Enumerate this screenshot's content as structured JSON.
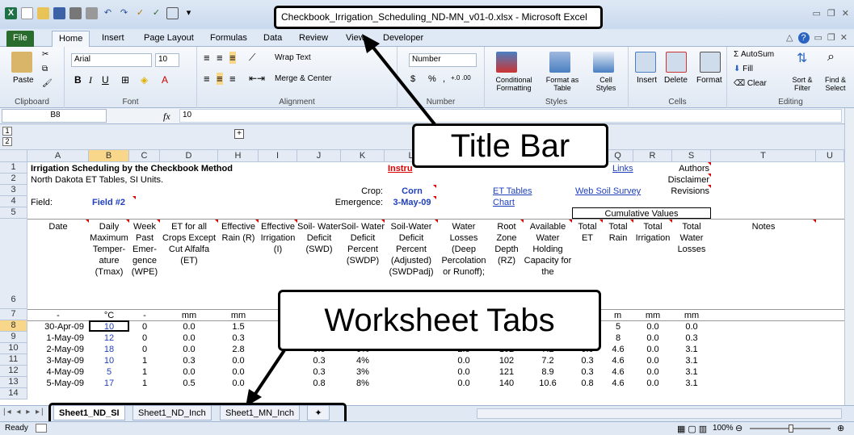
{
  "window": {
    "title": "Checkbook_Irrigation_Scheduling_ND-MN_v01-0.xlsx - Microsoft Excel"
  },
  "ribbon_tabs": [
    "File",
    "Home",
    "Insert",
    "Page Layout",
    "Formulas",
    "Data",
    "Review",
    "View",
    "Developer"
  ],
  "ribbon": {
    "clipboard": {
      "label": "Clipboard",
      "paste": "Paste"
    },
    "font": {
      "label": "Font",
      "name": "Arial",
      "size": "10",
      "bold": "B",
      "italic": "I",
      "underline": "U"
    },
    "alignment": {
      "label": "Alignment",
      "wrap": "Wrap Text",
      "merge": "Merge & Center"
    },
    "number": {
      "label": "Number",
      "format": "Number",
      "currency": "$",
      "percent": "%",
      "comma": ",",
      "inc": "+.0 .00",
      "dec": ".00 +.0"
    },
    "styles": {
      "label": "Styles",
      "cond": "Conditional Formatting",
      "format_table": "Format as Table",
      "cell_styles": "Cell Styles"
    },
    "cells": {
      "label": "Cells",
      "insert": "Insert",
      "delete": "Delete",
      "format": "Format"
    },
    "editing": {
      "label": "Editing",
      "autosum": "AutoSum",
      "fill": "Fill",
      "clear": "Clear",
      "sort": "Sort & Filter",
      "find": "Find & Select"
    }
  },
  "formula_bar": {
    "name_box": "B8",
    "fx": "fx",
    "value": "10"
  },
  "columns": [
    "A",
    "B",
    "C",
    "D",
    "H",
    "I",
    "J",
    "K",
    "L",
    "M",
    "N",
    "O",
    "P",
    "Q",
    "R",
    "S",
    "T",
    "U"
  ],
  "rows": [
    "1",
    "2",
    "3",
    "4",
    "5",
    "6",
    "7",
    "8",
    "9",
    "10",
    "11",
    "12",
    "13",
    "14"
  ],
  "sheet": {
    "r1_title": "Irrigation Scheduling by the Checkbook Method",
    "r1_instr": "Instru",
    "r1_links": "Links",
    "r1_authors": "Authors",
    "r2_subtitle": "North Dakota ET Tables, SI Units.",
    "r2_disclaimer": "Disclaimer",
    "r3_crop_label": "Crop:",
    "r3_crop": "Corn",
    "r3_et_tables": "ET Tables",
    "r3_web_soil": "Web Soil Survey",
    "r3_revisions": "Revisions",
    "r4_field_label": "Field:",
    "r4_field": "Field #2",
    "r4_emergence_label": "Emergence:",
    "r4_emergence": "3-May-09",
    "r4_chart": "Chart",
    "r5_cumulative": "Cumulative Values",
    "h_date": "Date",
    "h_B": "Daily Maximum Temper- ature (Tmax)",
    "h_C": "Week Past Emer- gence (WPE)",
    "h_D": "ET for all Crops Except Cut Alfalfa (ET)",
    "h_H": "Effective Rain (R)",
    "h_I": "Effective Irrigation (I)",
    "h_J": "Soil- Water Deficit (SWD)",
    "h_K": "Soil- Water Deficit Percent (SWDP)",
    "h_L": "Soil-Water Deficit Percent (Adjusted) (SWDPadj)",
    "h_M": "Water Losses (Deep Percolation or Runoff);",
    "h_N": "Root Zone Depth (RZ)",
    "h_O": "Available Water Holding Capacity for the",
    "h_P": "Total ET",
    "h_Q": "Total Rain",
    "h_R": "Total Irrigation",
    "h_S": "Total Water Losses",
    "h_T": "Notes",
    "units": {
      "A": "-",
      "B": "°C",
      "C": "-",
      "D": "mm",
      "H": "mm",
      "Q": "m",
      "R": "mm",
      "S": "mm"
    },
    "data": [
      {
        "date": "30-Apr-09",
        "B": "10",
        "C": "0",
        "D": "0.0",
        "H": "1.5",
        "J": "",
        "K": "",
        "M": "",
        "N": "",
        "O": "",
        "P": "",
        "Q": "5",
        "R": "0.0",
        "S": "0.0"
      },
      {
        "date": "1-May-09",
        "B": "12",
        "C": "0",
        "D": "0.0",
        "H": "0.3",
        "J": "",
        "K": "",
        "M": "",
        "N": "",
        "O": "",
        "P": "",
        "Q": "8",
        "R": "0.0",
        "S": "0.3"
      },
      {
        "date": "2-May-09",
        "B": "18",
        "C": "0",
        "D": "0.0",
        "H": "2.8",
        "J": "0.0",
        "K": "0%",
        "M": "2.8",
        "N": "102",
        "O": "7.2",
        "P": "0.0",
        "Q": "4.6",
        "R": "0.0",
        "S": "3.1"
      },
      {
        "date": "3-May-09",
        "B": "10",
        "C": "1",
        "D": "0.3",
        "H": "0.0",
        "J": "0.3",
        "K": "4%",
        "M": "0.0",
        "N": "102",
        "O": "7.2",
        "P": "0.3",
        "Q": "4.6",
        "R": "0.0",
        "S": "3.1"
      },
      {
        "date": "4-May-09",
        "B": "5",
        "C": "1",
        "D": "0.0",
        "H": "0.0",
        "J": "0.3",
        "K": "3%",
        "M": "0.0",
        "N": "121",
        "O": "8.9",
        "P": "0.3",
        "Q": "4.6",
        "R": "0.0",
        "S": "3.1"
      },
      {
        "date": "5-May-09",
        "B": "17",
        "C": "1",
        "D": "0.5",
        "H": "0.0",
        "J": "0.8",
        "K": "8%",
        "M": "0.0",
        "N": "140",
        "O": "10.6",
        "P": "0.8",
        "Q": "4.6",
        "R": "0.0",
        "S": "3.1"
      }
    ]
  },
  "sheet_tabs": [
    "Sheet1_ND_SI",
    "Sheet1_ND_Inch",
    "Sheet1_MN_Inch"
  ],
  "status": {
    "ready": "Ready",
    "zoom": "100%"
  },
  "callouts": {
    "title_bar": "Title Bar",
    "worksheet_tabs": "Worksheet Tabs"
  },
  "colors": {
    "accent": "#2a6c2d",
    "selection": "#f8d78a",
    "link": "#1f3fbd"
  }
}
